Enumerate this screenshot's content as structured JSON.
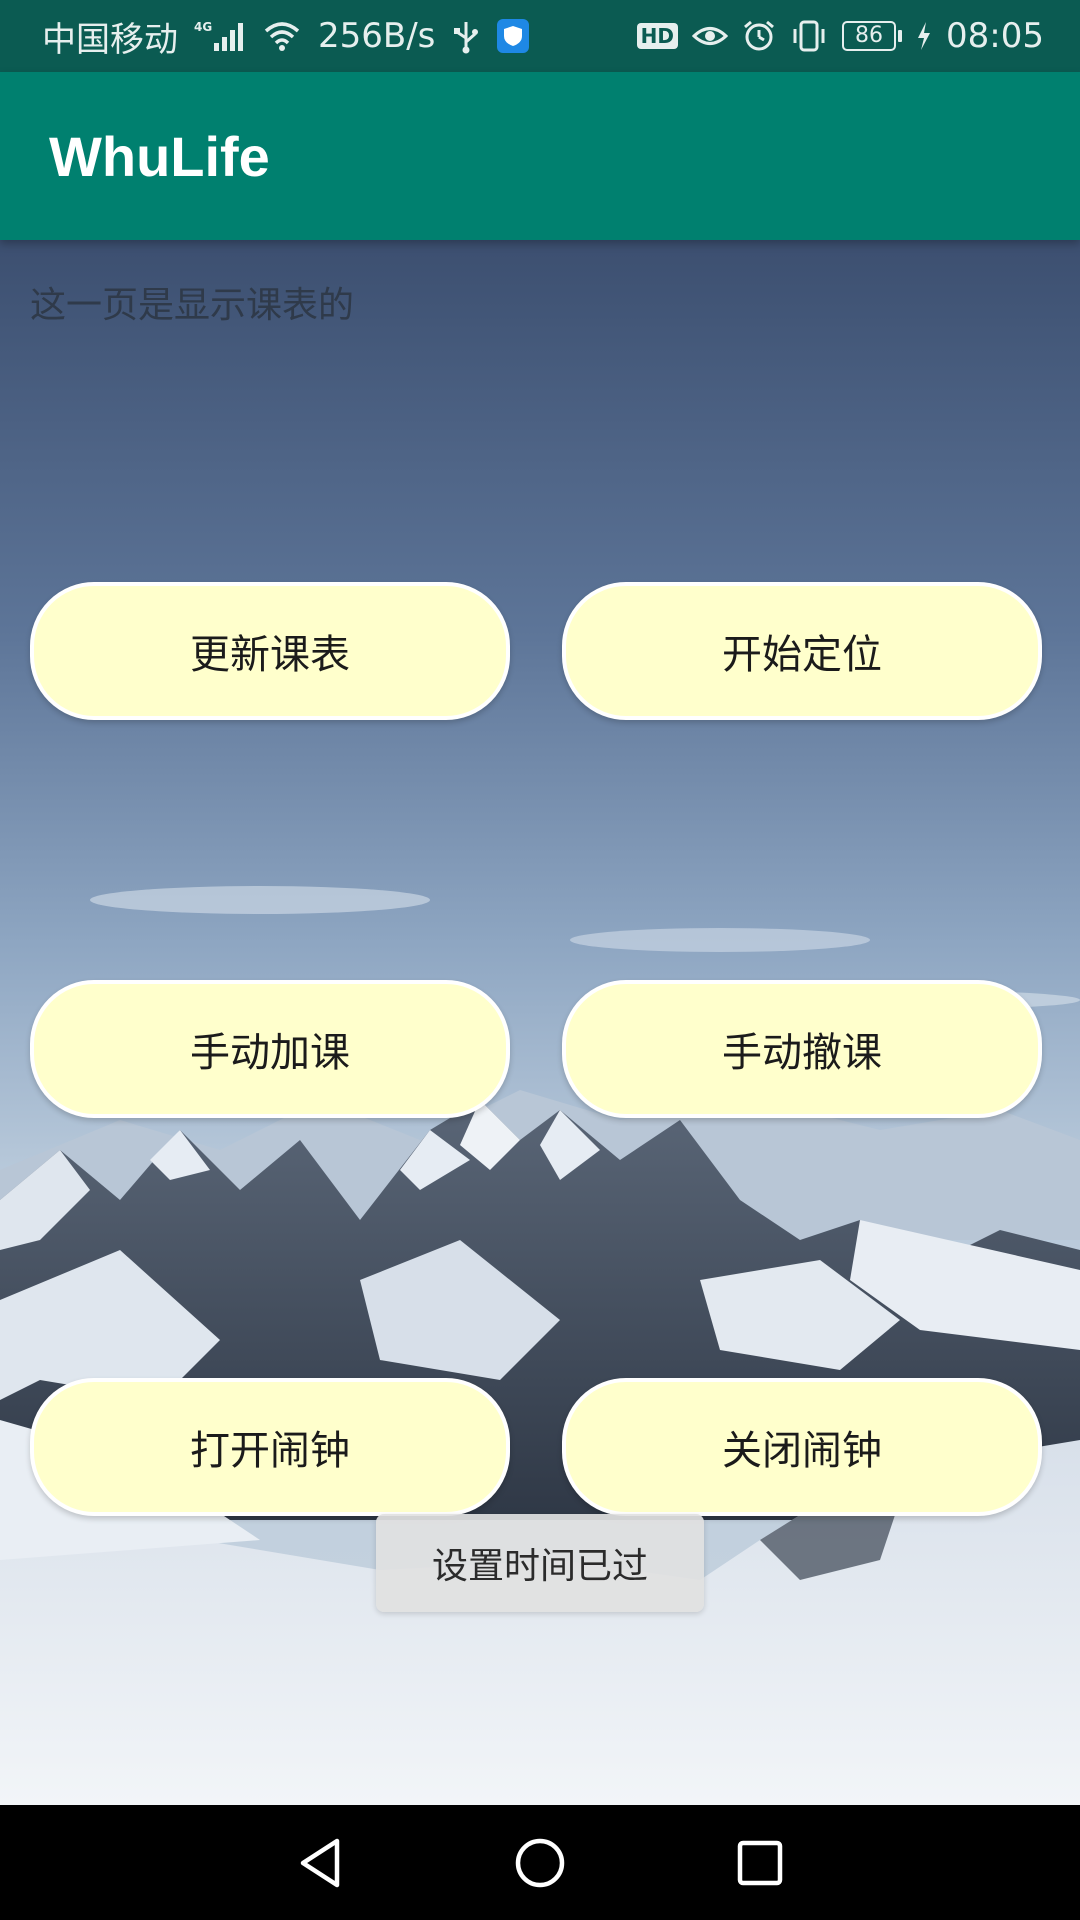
{
  "status_bar": {
    "carrier": "中国移动",
    "network": "4G",
    "speed": "256B/s",
    "battery": "86",
    "time": "08:05",
    "hd_label": "HD"
  },
  "app_bar": {
    "title": "WhuLife"
  },
  "main": {
    "page_text": "这一页是显示课表的",
    "buttons": {
      "update_schedule": "更新课表",
      "start_locating": "开始定位",
      "add_course": "手动加课",
      "remove_course": "手动撤课",
      "open_alarm": "打开闹钟",
      "close_alarm": "关闭闹钟"
    },
    "toast": "设置时间已过"
  },
  "colors": {
    "app_bar": "#00806f",
    "status_bar": "#0b5b52",
    "button_fill": "#ffffcc"
  }
}
